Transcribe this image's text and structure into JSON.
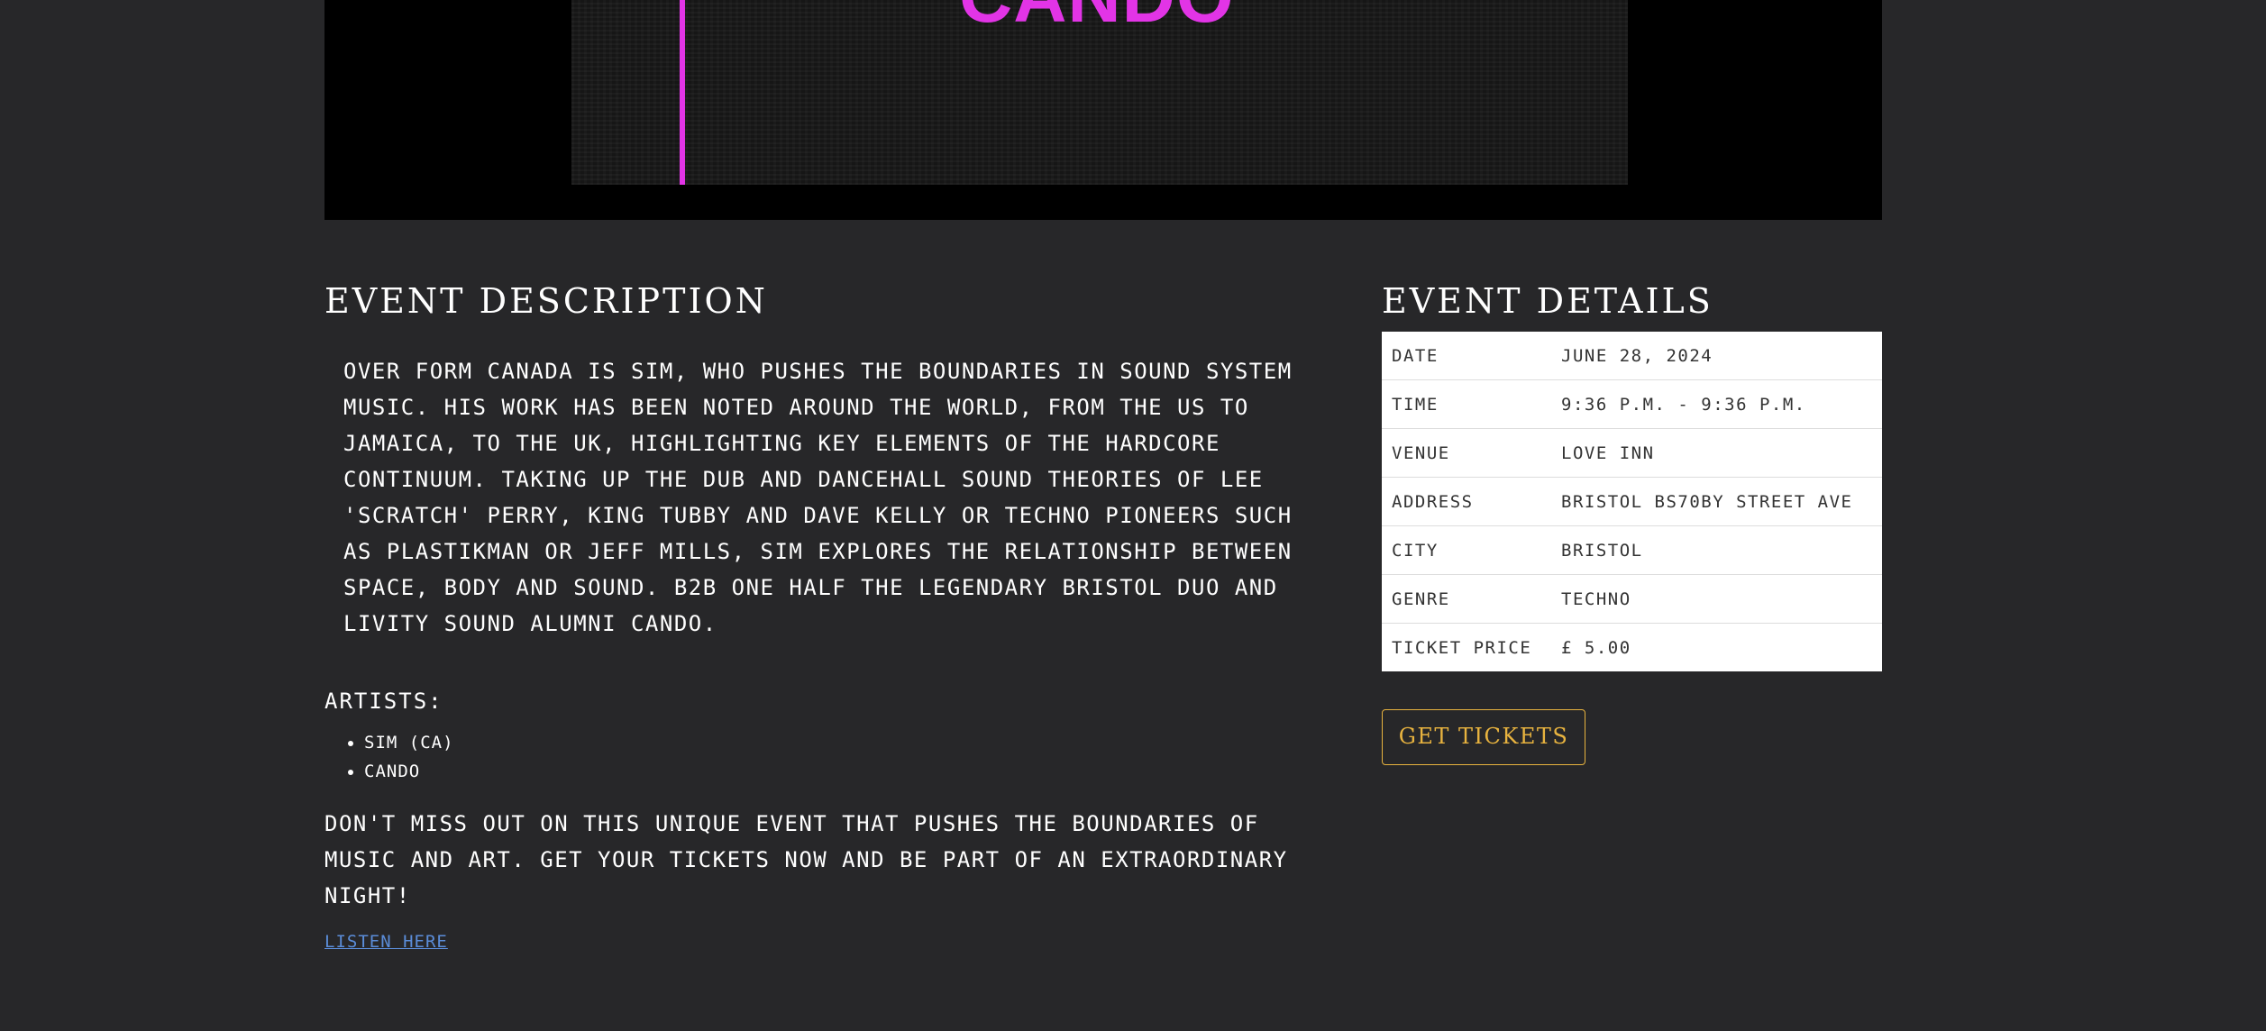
{
  "banner": {
    "text": "CANDO",
    "accent_color": "#e234e6"
  },
  "description": {
    "title": "EVENT DESCRIPTION",
    "body": "OVER FORM CANADA IS SIM, WHO PUSHES THE BOUNDARIES IN SOUND SYSTEM MUSIC. HIS WORK HAS BEEN NOTED AROUND THE WORLD, FROM THE US TO JAMAICA, TO THE UK, HIGHLIGHTING KEY ELEMENTS OF THE HARDCORE CONTINUUM. TAKING UP THE DUB AND DANCEHALL SOUND THEORIES OF LEE 'SCRATCH' PERRY, KING TUBBY AND DAVE KELLY OR TECHNO PIONEERS SUCH AS PLASTIKMAN OR JEFF MILLS, SIM EXPLORES THE RELATIONSHIP BETWEEN SPACE, BODY AND SOUND. B2B ONE HALF THE LEGENDARY BRISTOL DUO AND LIVITY SOUND ALUMNI CANDO.",
    "artists_heading": "ARTISTS:",
    "artists": [
      "SIM (CA)",
      "CANDO"
    ],
    "closing": "DON'T MISS OUT ON THIS UNIQUE EVENT THAT PUSHES THE BOUNDARIES OF MUSIC AND ART. GET YOUR TICKETS NOW AND BE PART OF AN EXTRAORDINARY NIGHT!",
    "listen_link": "LISTEN HERE"
  },
  "details": {
    "title": "EVENT DETAILS",
    "rows": [
      {
        "label": "DATE",
        "value": "JUNE 28, 2024"
      },
      {
        "label": "TIME",
        "value": "9:36 P.M. - 9:36 P.M."
      },
      {
        "label": "VENUE",
        "value": "LOVE INN"
      },
      {
        "label": "ADDRESS",
        "value": "BRISTOL BS70BY STREET AVE"
      },
      {
        "label": "CITY",
        "value": "BRISTOL"
      },
      {
        "label": "GENRE",
        "value": "TECHNO"
      },
      {
        "label": "TICKET PRICE",
        "value": "£ 5.00"
      }
    ],
    "tickets_button": "GET TICKETS",
    "button_color": "#e8b33f"
  },
  "colors": {
    "background": "#272729",
    "link": "#5b8dd9"
  }
}
